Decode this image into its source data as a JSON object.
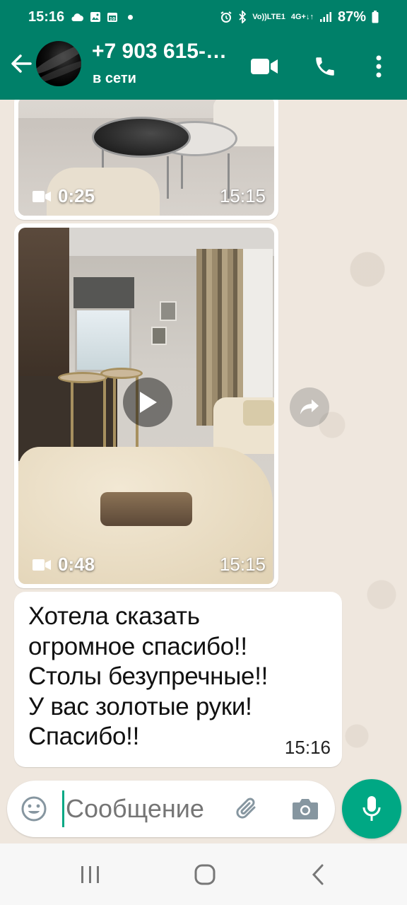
{
  "status_bar": {
    "time": "15:16",
    "network_top": "Vo))",
    "network_bottom": "LTE1",
    "gen_top": "4G+",
    "gen_bottom": "↓↑",
    "battery": "87%"
  },
  "header": {
    "contact_name": "+7 903 615-…",
    "contact_status": "в сети"
  },
  "messages": {
    "video1": {
      "duration": "0:25",
      "time": "15:15"
    },
    "video2": {
      "duration": "0:48",
      "time": "15:15"
    },
    "text1": {
      "text": "Хотела сказать\nогромное спасибо!!\nСтолы безупречные!!\nУ вас золотые руки!\nСпасибо!!",
      "time": "15:16"
    }
  },
  "composer": {
    "placeholder": "Сообщение"
  },
  "colors": {
    "header": "#008069",
    "accent": "#00a884",
    "chat_bg": "#efe7de",
    "bubble": "#ffffff"
  },
  "icons": {
    "status": [
      "cloud-icon",
      "gallery-icon",
      "calendar-icon",
      "alarm-icon",
      "bluetooth-icon",
      "signal-icon",
      "battery-icon"
    ],
    "header": [
      "back-arrow-icon",
      "video-call-icon",
      "phone-icon",
      "more-vert-icon"
    ],
    "composer": [
      "emoji-icon",
      "attach-icon",
      "camera-icon",
      "mic-icon"
    ],
    "nav": [
      "recents-icon",
      "home-icon",
      "back-icon"
    ]
  }
}
